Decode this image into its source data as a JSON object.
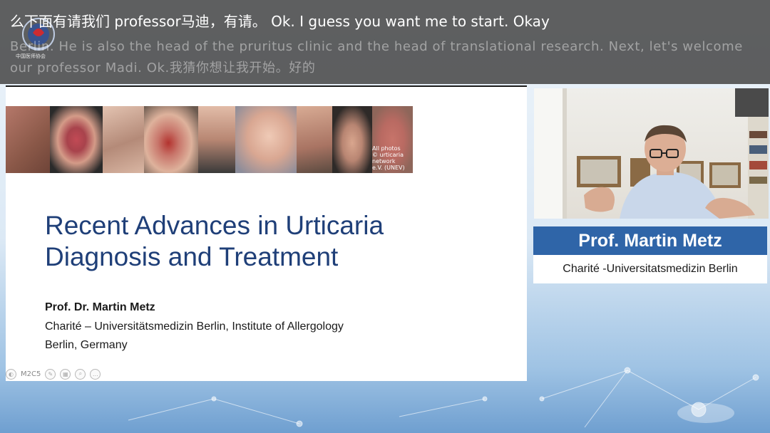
{
  "subtitles": {
    "line1": "么下面有请我们 professor马迪，有请。 Ok. I guess you want me to start. Okay",
    "line2": "Berlin. He is also the head of the pruritus clinic and the head of translational research. Next, let's welcome our professor Madi. Ok.我猜你想让我开始。好的"
  },
  "logo": {
    "icon": "association-emblem-icon",
    "caption": "中国医师协会"
  },
  "slide": {
    "photo_credit": "All photos © urticaria network e.V. (UNEV)",
    "title_line1": "Recent Advances in Urticaria",
    "title_line2": "Diagnosis and Treatment",
    "author": "Prof. Dr. Martin Metz",
    "affiliation_line1": "Charité – Universitätsmedizin Berlin, Institute of Allergology",
    "affiliation_line2": "Berlin, Germany",
    "toolbar_label": "M2C5",
    "title_color": "#1f3f78"
  },
  "speaker": {
    "name": "Prof. Martin Metz",
    "affiliation": "Charité -Universitatsmedizin Berlin",
    "banner_color": "#2f65a8"
  }
}
